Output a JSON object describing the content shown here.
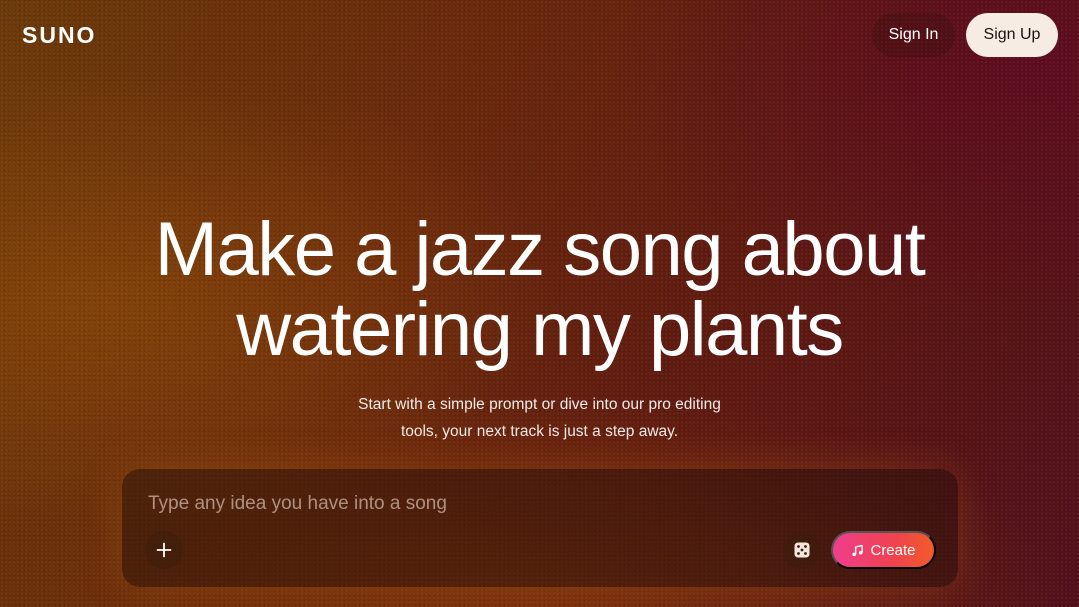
{
  "header": {
    "logo": "SUNO",
    "sign_in_label": "Sign In",
    "sign_up_label": "Sign Up"
  },
  "hero": {
    "headline_line1": "Make a jazz song about",
    "headline_line2": "watering my plants",
    "subtext_line1": "Start with a simple prompt or dive into our pro editing",
    "subtext_line2": "tools, your next track is just a step away."
  },
  "composer": {
    "placeholder": "Type any idea you have into a song",
    "value": "",
    "add_icon": "plus-icon",
    "random_icon": "dice-icon",
    "create_icon": "music-note-icon",
    "create_label": "Create"
  },
  "colors": {
    "create_gradient_start": "#ef3e8c",
    "create_gradient_end": "#f25b2a",
    "signup_bg": "#f7ece4"
  }
}
